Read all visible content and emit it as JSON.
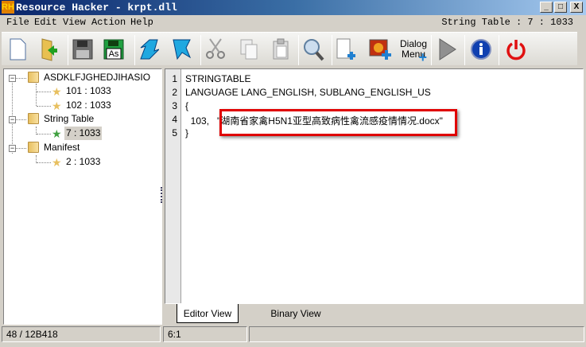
{
  "window": {
    "title": "Resource Hacker  -  krpt.dll",
    "logo": "RH",
    "minimize": "_",
    "maximize": "□",
    "close": "X"
  },
  "menu": {
    "items": [
      "File",
      "Edit",
      "View",
      "Action",
      "Help"
    ],
    "resource_title": "String Table : 7 : 1033"
  },
  "toolbar": {
    "dialog_menu_label_1": "Dialog",
    "dialog_menu_label_2": "Menu",
    "icons": [
      "new-file-icon",
      "open-folder-icon",
      "save-icon",
      "save-as-icon",
      "compile-icon",
      "bookmark-icon",
      "cut-icon",
      "copy-icon",
      "paste-icon",
      "search-icon",
      "add-resource-icon",
      "add-image-icon",
      "add-dialog-menu-icon",
      "run-icon",
      "about-icon",
      "exit-icon"
    ],
    "save_as_label": "As"
  },
  "tree": {
    "groups": [
      {
        "label": "ASDKLFJGHEDJIHASIO",
        "items": [
          "101 : 1033",
          "102 : 1033"
        ]
      },
      {
        "label": "String Table",
        "items": [
          "7 : 1033"
        ]
      },
      {
        "label": "Manifest",
        "items": [
          "2 : 1033"
        ]
      }
    ],
    "selected": "7 : 1033"
  },
  "editor": {
    "line_numbers": [
      "1",
      "2",
      "3",
      "4",
      "5"
    ],
    "lines": [
      "STRINGTABLE",
      "LANGUAGE LANG_ENGLISH, SUBLANG_ENGLISH_US",
      "{",
      "  103,   \"湖南省家禽H5N1亚型高致病性禽流感疫情情况.docx\"",
      "}"
    ],
    "highlight_color": "#e00000"
  },
  "tabs": {
    "editor_view": "Editor View",
    "binary_view": "Binary View",
    "active": "Editor View"
  },
  "status": {
    "offset": "48 / 12B418",
    "position": "6:1",
    "extra": ""
  }
}
